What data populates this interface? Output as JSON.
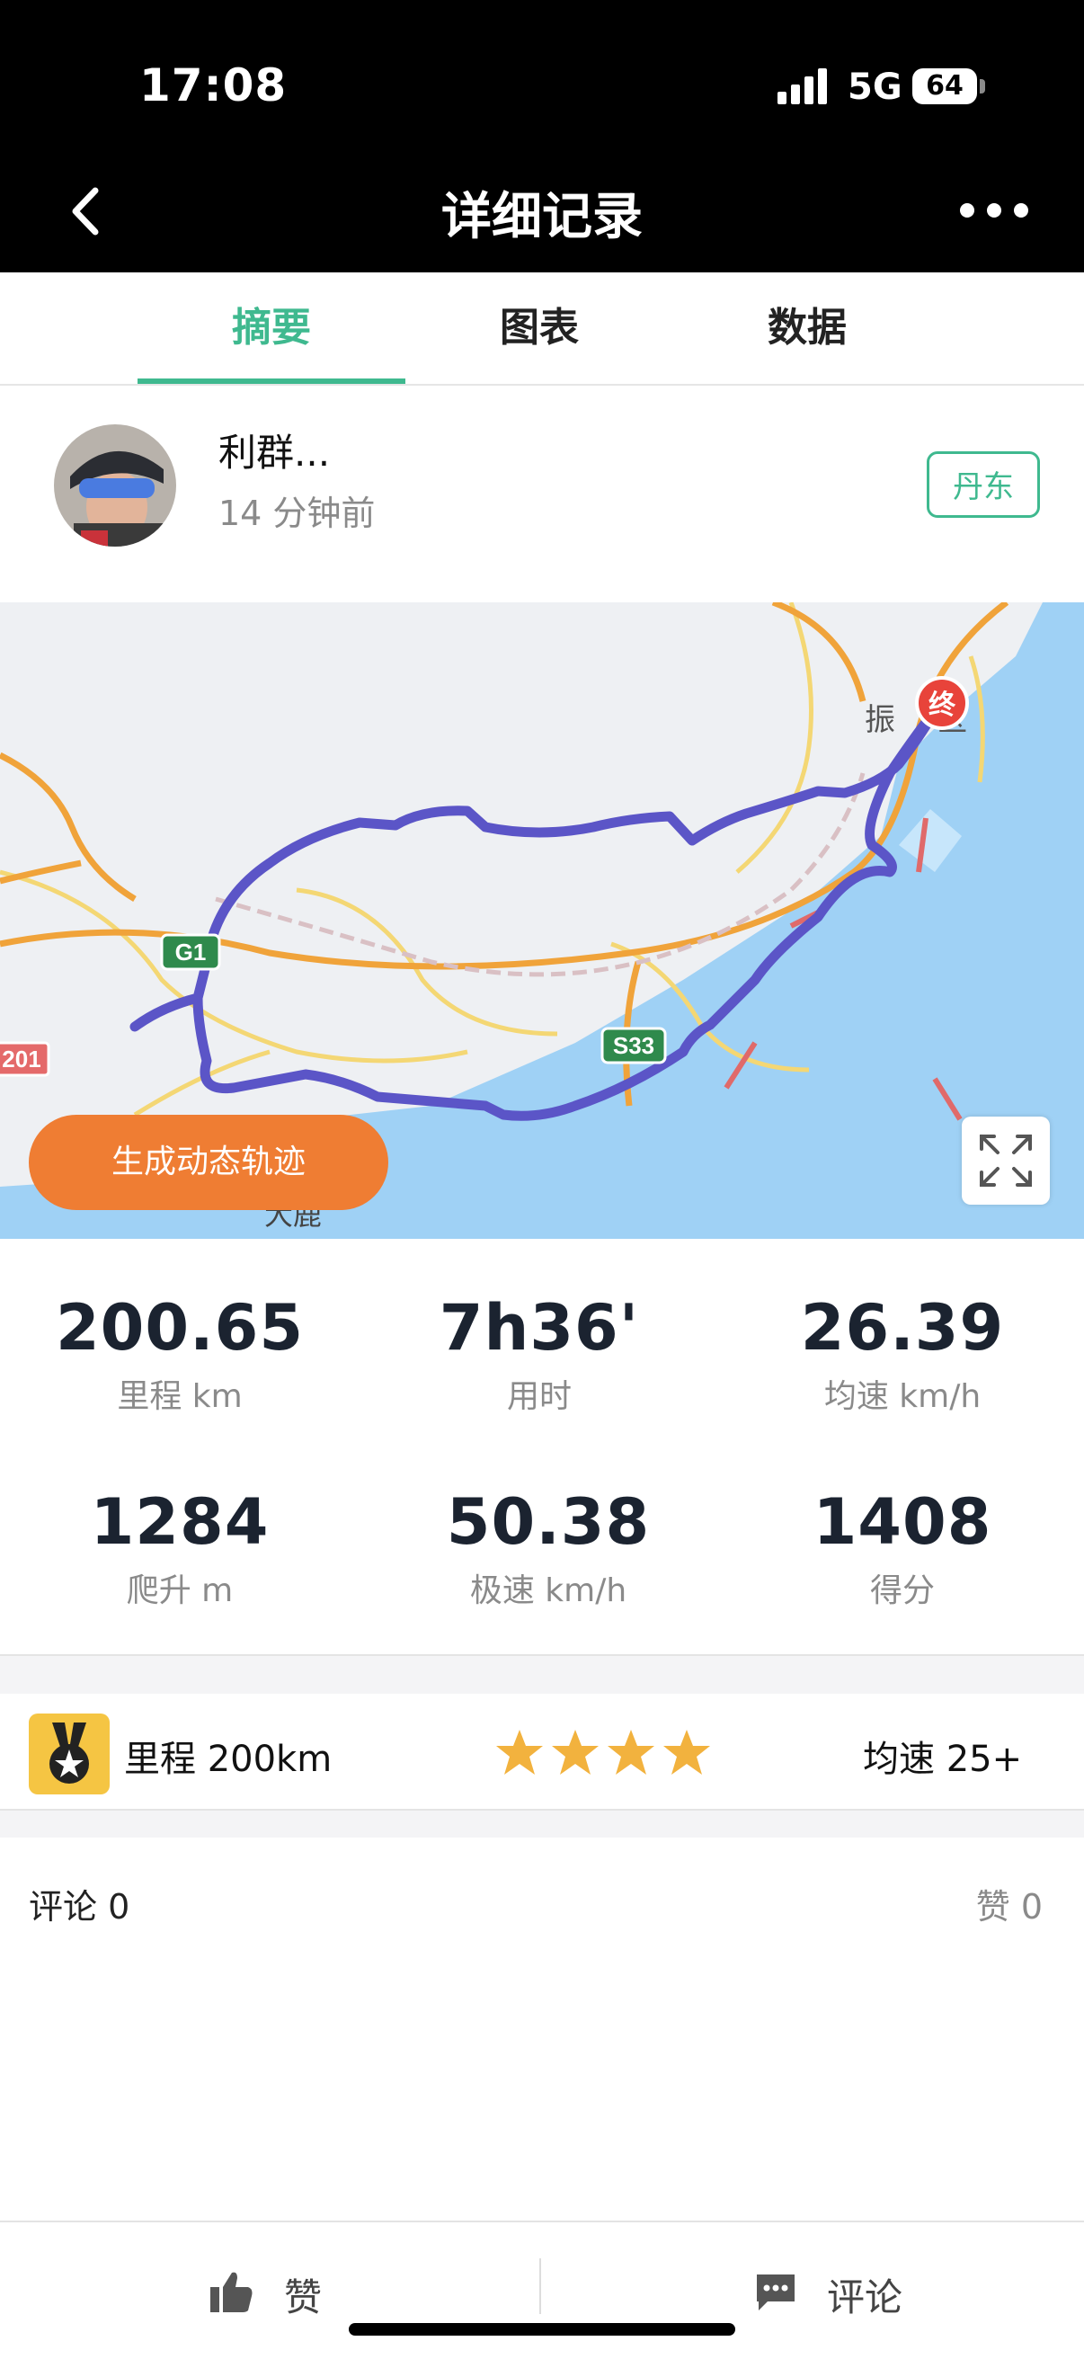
{
  "status_bar": {
    "time": "17:08",
    "network": "5G",
    "battery": "64"
  },
  "nav": {
    "title": "详细记录",
    "back_icon": "chevron-left-icon",
    "more_icon": "more-dots-icon"
  },
  "tabs": [
    {
      "label": "摘要",
      "active": true
    },
    {
      "label": "图表",
      "active": false
    },
    {
      "label": "数据",
      "active": false
    }
  ],
  "profile": {
    "name": "利群...",
    "posted": "14 分钟前",
    "city": "丹东"
  },
  "map": {
    "labels": {
      "end_marker": "终",
      "place_top": "振",
      "place_top_suffix": "区",
      "place_bottom": "大鹿",
      "highway_g": "G1",
      "highway_s": "S33",
      "road_201": "201"
    },
    "generate_button": "生成动态轨迹",
    "expand_icon": "expand-icon",
    "colors": {
      "route": "#5b55c7",
      "water": "#9fd1f5",
      "highway": "#f0a33a"
    }
  },
  "stats": [
    {
      "value": "200.65",
      "label": "里程 km"
    },
    {
      "value": "7h36'",
      "label": "用时"
    },
    {
      "value": "26.39",
      "label": "均速 km/h"
    },
    {
      "value": "1284",
      "label": "爬升 m"
    },
    {
      "value": "50.38",
      "label": "极速 km/h"
    },
    {
      "value": "1408",
      "label": "得分"
    }
  ],
  "achievements": {
    "distance": "里程 200km",
    "stars": 4,
    "speed": "均速 25+",
    "medal_icon": "medal-icon",
    "star_color": "#f2b23e"
  },
  "social": {
    "comments": "评论 0",
    "likes": "赞 0"
  },
  "bottom_bar": {
    "like_label": "赞",
    "comment_label": "评论"
  }
}
